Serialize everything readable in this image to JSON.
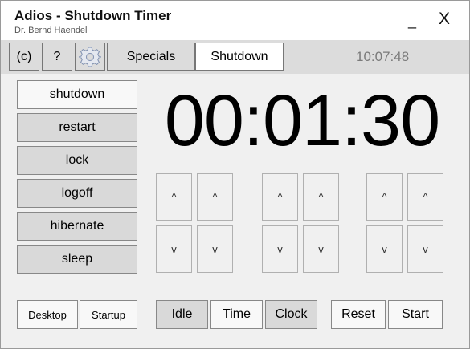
{
  "window": {
    "title": "Adios - Shutdown Timer",
    "subtitle": "Dr. Bernd Haendel",
    "minimize_label": "_",
    "close_label": "X"
  },
  "toolbar": {
    "about_label": "(c)",
    "help_label": "?",
    "settings_icon": "gear-icon",
    "specials_label": "Specials",
    "shutdown_label": "Shutdown",
    "clock": "10:07:48"
  },
  "actions": [
    "shutdown",
    "restart",
    "lock",
    "logoff",
    "hibernate",
    "sleep"
  ],
  "timer": {
    "display": "00:01:30",
    "up_label": "^",
    "down_label": "v"
  },
  "bottom": {
    "desktop_label": "Desktop",
    "startup_label": "Startup",
    "idle_label": "Idle",
    "time_label": "Time",
    "clock_label": "Clock",
    "reset_label": "Reset",
    "start_label": "Start"
  }
}
